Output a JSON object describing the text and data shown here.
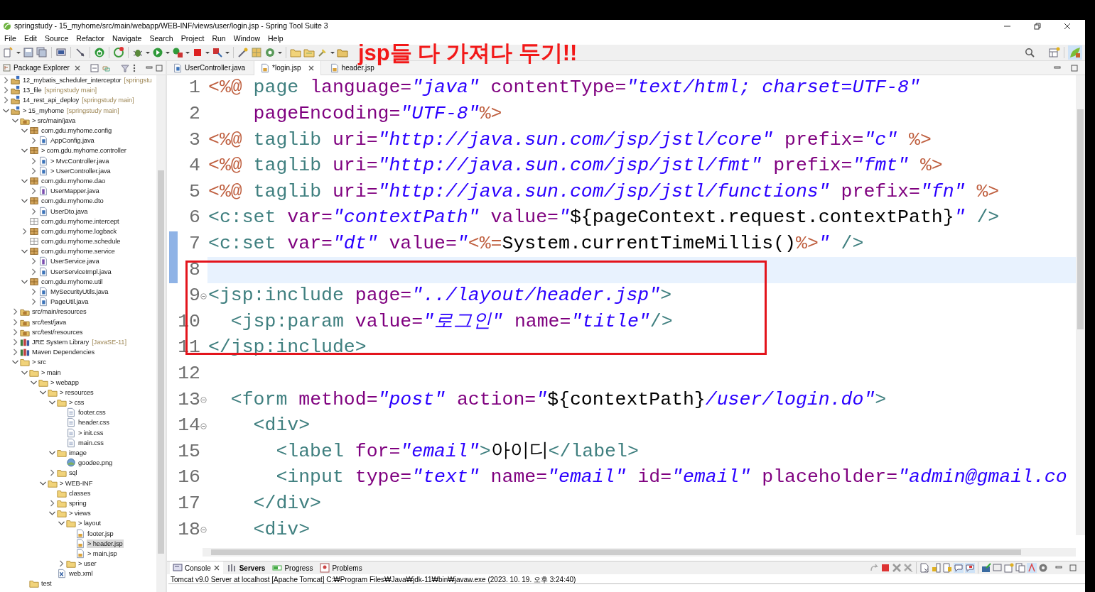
{
  "window": {
    "title": "springstudy - 15_myhome/src/main/webapp/WEB-INF/views/user/login.jsp - Spring Tool Suite 3"
  },
  "menu": [
    "File",
    "Edit",
    "Source",
    "Refactor",
    "Navigate",
    "Search",
    "Project",
    "Run",
    "Window",
    "Help"
  ],
  "annotation": {
    "text": "jsp들 다 가져다 두기!!"
  },
  "explorer": {
    "title": "Package Explorer",
    "items": [
      {
        "label": "12_mybatis_scheduler_interceptor",
        "detail": "[springstu",
        "kind": "project",
        "expanded": false,
        "selected": false
      },
      {
        "label": "13_file",
        "detail": "[springstudy main]",
        "kind": "project",
        "expanded": false,
        "selected": false
      },
      {
        "label": "14_rest_api_deploy",
        "detail": "[springstudy main]",
        "kind": "project",
        "expanded": false,
        "selected": false
      },
      {
        "label": "> 15_myhome",
        "detail": "[springstudy main]",
        "kind": "project",
        "expanded": true,
        "selected": false,
        "children": [
          {
            "label": "> src/main/java",
            "kind": "srcfolder",
            "expanded": true,
            "selected": false,
            "children": [
              {
                "label": "com.gdu.myhome.config",
                "kind": "package",
                "expanded": true,
                "selected": false,
                "children": [
                  {
                    "label": "AppConfig.java",
                    "kind": "java",
                    "expanded": false,
                    "selected": false
                  }
                ]
              },
              {
                "label": "> com.gdu.myhome.controller",
                "kind": "package",
                "expanded": true,
                "selected": false,
                "children": [
                  {
                    "label": "> MvcController.java",
                    "kind": "java",
                    "expanded": false,
                    "selected": false
                  },
                  {
                    "label": "> UserController.java",
                    "kind": "java",
                    "expanded": false,
                    "selected": false
                  }
                ]
              },
              {
                "label": "com.gdu.myhome.dao",
                "kind": "package",
                "expanded": true,
                "selected": false,
                "children": [
                  {
                    "label": "UserMapper.java",
                    "kind": "interface",
                    "expanded": false,
                    "selected": false
                  }
                ]
              },
              {
                "label": "com.gdu.myhome.dto",
                "kind": "package",
                "expanded": true,
                "selected": false,
                "children": [
                  {
                    "label": "UserDto.java",
                    "kind": "java",
                    "expanded": false,
                    "selected": false
                  }
                ]
              },
              {
                "label": "com.gdu.myhome.intercept",
                "kind": "emptypkg",
                "selected": false
              },
              {
                "label": "com.gdu.myhome.logback",
                "kind": "package",
                "expanded": false,
                "selected": false
              },
              {
                "label": "com.gdu.myhome.schedule",
                "kind": "emptypkg",
                "selected": false
              },
              {
                "label": "com.gdu.myhome.service",
                "kind": "package",
                "expanded": true,
                "selected": false,
                "children": [
                  {
                    "label": "UserService.java",
                    "kind": "interface",
                    "expanded": false,
                    "selected": false
                  },
                  {
                    "label": "UserServiceImpl.java",
                    "kind": "java",
                    "expanded": false,
                    "selected": false
                  }
                ]
              },
              {
                "label": "com.gdu.myhome.util",
                "kind": "package",
                "expanded": true,
                "selected": false,
                "children": [
                  {
                    "label": "MySecurityUtils.java",
                    "kind": "java",
                    "expanded": false,
                    "selected": false
                  },
                  {
                    "label": "PageUtil.java",
                    "kind": "java",
                    "expanded": false,
                    "selected": false
                  }
                ]
              }
            ]
          },
          {
            "label": "src/main/resources",
            "kind": "srcfolder",
            "expanded": false,
            "selected": false
          },
          {
            "label": "src/test/java",
            "kind": "srcfolder",
            "expanded": false,
            "selected": false
          },
          {
            "label": "src/test/resources",
            "kind": "srcfolder",
            "expanded": false,
            "selected": false
          },
          {
            "label": "JRE System Library",
            "detail": "[JavaSE-11]",
            "kind": "library",
            "expanded": false,
            "selected": false
          },
          {
            "label": "Maven Dependencies",
            "kind": "library",
            "expanded": false,
            "selected": false
          },
          {
            "label": "> src",
            "kind": "folder",
            "expanded": true,
            "selected": false,
            "children": [
              {
                "label": "> main",
                "kind": "folder",
                "expanded": true,
                "selected": false,
                "children": [
                  {
                    "label": "> webapp",
                    "kind": "folder",
                    "expanded": true,
                    "selected": false,
                    "children": [
                      {
                        "label": "> resources",
                        "kind": "folder",
                        "expanded": true,
                        "selected": false,
                        "children": [
                          {
                            "label": "> css",
                            "kind": "folder",
                            "expanded": true,
                            "selected": false,
                            "children": [
                              {
                                "label": "footer.css",
                                "kind": "file",
                                "selected": false
                              },
                              {
                                "label": "header.css",
                                "kind": "file",
                                "selected": false
                              },
                              {
                                "label": "> init.css",
                                "kind": "file",
                                "selected": false
                              },
                              {
                                "label": "main.css",
                                "kind": "file",
                                "selected": false
                              }
                            ]
                          },
                          {
                            "label": "image",
                            "kind": "folder",
                            "expanded": true,
                            "selected": false,
                            "children": [
                              {
                                "label": "goodee.png",
                                "kind": "image",
                                "selected": false
                              }
                            ]
                          },
                          {
                            "label": "sql",
                            "kind": "folder",
                            "expanded": false,
                            "selected": false
                          }
                        ]
                      },
                      {
                        "label": "> WEB-INF",
                        "kind": "folder",
                        "expanded": true,
                        "selected": false,
                        "children": [
                          {
                            "label": "classes",
                            "kind": "folder",
                            "selected": false
                          },
                          {
                            "label": "spring",
                            "kind": "folder",
                            "expanded": false,
                            "selected": false
                          },
                          {
                            "label": "> views",
                            "kind": "folder",
                            "expanded": true,
                            "selected": false,
                            "children": [
                              {
                                "label": "> layout",
                                "kind": "folder",
                                "expanded": true,
                                "selected": false,
                                "children": [
                                  {
                                    "label": "footer.jsp",
                                    "kind": "jsp",
                                    "selected": false
                                  },
                                  {
                                    "label": "> header.jsp",
                                    "kind": "jsp",
                                    "selected": true
                                  },
                                  {
                                    "label": "> main.jsp",
                                    "kind": "jsp",
                                    "selected": false
                                  }
                                ]
                              },
                              {
                                "label": "> user",
                                "kind": "folder",
                                "expanded": false,
                                "selected": false
                              }
                            ]
                          },
                          {
                            "label": "web.xml",
                            "kind": "xml",
                            "selected": false
                          }
                        ]
                      }
                    ]
                  }
                ]
              },
              {
                "label": "test",
                "kind": "folder",
                "selected": false
              }
            ]
          }
        ]
      }
    ]
  },
  "editor": {
    "tabs": [
      {
        "label": "UserController.java",
        "kind": "java",
        "selected": false
      },
      {
        "label": "*login.jsp",
        "kind": "jsp",
        "selected": true
      },
      {
        "label": "header.jsp",
        "kind": "jsp",
        "selected": false
      }
    ],
    "lines": [
      {
        "number": "1",
        "current": false,
        "changed": false,
        "fold": false,
        "tokens": [
          {
            "kind": "dir",
            "text": "<%@"
          },
          {
            "kind": "kw",
            "text": " page"
          },
          {
            "kind": "attr",
            "text": " language="
          },
          {
            "kind": "val",
            "text": "\"java\""
          },
          {
            "kind": "attr",
            "text": " contentType="
          },
          {
            "kind": "val",
            "text": "\"text/html; charset=UTF-8\""
          }
        ]
      },
      {
        "number": "2",
        "current": false,
        "changed": false,
        "fold": false,
        "tokens": [
          {
            "kind": "attr",
            "text": "    pageEncoding="
          },
          {
            "kind": "val",
            "text": "\"UTF-8\""
          },
          {
            "kind": "dir",
            "text": "%>"
          }
        ]
      },
      {
        "number": "3",
        "current": false,
        "changed": false,
        "fold": false,
        "tokens": [
          {
            "kind": "dir",
            "text": "<%@"
          },
          {
            "kind": "kw",
            "text": " taglib"
          },
          {
            "kind": "attr",
            "text": " uri="
          },
          {
            "kind": "val",
            "text": "\"http://java.sun.com/jsp/jstl/core\""
          },
          {
            "kind": "attr",
            "text": " prefix="
          },
          {
            "kind": "val",
            "text": "\"c\""
          },
          {
            "kind": "dir",
            "text": " %>"
          }
        ]
      },
      {
        "number": "4",
        "current": false,
        "changed": false,
        "fold": false,
        "tokens": [
          {
            "kind": "dir",
            "text": "<%@"
          },
          {
            "kind": "kw",
            "text": " taglib"
          },
          {
            "kind": "attr",
            "text": " uri="
          },
          {
            "kind": "val",
            "text": "\"http://java.sun.com/jsp/jstl/fmt\""
          },
          {
            "kind": "attr",
            "text": " prefix="
          },
          {
            "kind": "val",
            "text": "\"fmt\""
          },
          {
            "kind": "dir",
            "text": " %>"
          }
        ]
      },
      {
        "number": "5",
        "current": false,
        "changed": false,
        "fold": false,
        "tokens": [
          {
            "kind": "dir",
            "text": "<%@"
          },
          {
            "kind": "kw",
            "text": " taglib"
          },
          {
            "kind": "attr",
            "text": " uri="
          },
          {
            "kind": "val",
            "text": "\"http://java.sun.com/jsp/jstl/functions\""
          },
          {
            "kind": "attr",
            "text": " prefix="
          },
          {
            "kind": "val",
            "text": "\"fn\""
          },
          {
            "kind": "dir",
            "text": " %>"
          }
        ]
      },
      {
        "number": "6",
        "current": false,
        "changed": false,
        "fold": false,
        "tokens": [
          {
            "kind": "tag",
            "text": "<c:set"
          },
          {
            "kind": "attr",
            "text": " var="
          },
          {
            "kind": "val",
            "text": "\"contextPath\""
          },
          {
            "kind": "attr",
            "text": " value="
          },
          {
            "kind": "val",
            "text": "\""
          },
          {
            "kind": "text",
            "text": "${pageContext.request.contextPath}"
          },
          {
            "kind": "val",
            "text": "\""
          },
          {
            "kind": "tag",
            "text": " />"
          }
        ]
      },
      {
        "number": "7",
        "current": false,
        "changed": true,
        "fold": false,
        "tokens": [
          {
            "kind": "tag",
            "text": "<c:set"
          },
          {
            "kind": "attr",
            "text": " var="
          },
          {
            "kind": "val",
            "text": "\"dt\""
          },
          {
            "kind": "attr",
            "text": " value="
          },
          {
            "kind": "val",
            "text": "\""
          },
          {
            "kind": "dir",
            "text": "<%="
          },
          {
            "kind": "text",
            "text": "System.currentTimeMillis()"
          },
          {
            "kind": "dir",
            "text": "%>"
          },
          {
            "kind": "val",
            "text": "\""
          },
          {
            "kind": "tag",
            "text": " />"
          }
        ]
      },
      {
        "number": "8",
        "current": true,
        "changed": true,
        "fold": false
      },
      {
        "number": "9",
        "current": false,
        "changed": false,
        "fold": true,
        "tokens": [
          {
            "kind": "tag",
            "text": "<jsp:include"
          },
          {
            "kind": "attr",
            "text": " page="
          },
          {
            "kind": "val",
            "text": "\"../layout/header.jsp\""
          },
          {
            "kind": "tag",
            "text": ">"
          }
        ]
      },
      {
        "number": "10",
        "current": false,
        "changed": false,
        "fold": false,
        "tokens": [
          {
            "kind": "tag",
            "text": "  <jsp:param"
          },
          {
            "kind": "attr",
            "text": " value="
          },
          {
            "kind": "val",
            "text": "\"로그인\""
          },
          {
            "kind": "attr",
            "text": " name="
          },
          {
            "kind": "val",
            "text": "\"title\""
          },
          {
            "kind": "tag",
            "text": "/>"
          }
        ]
      },
      {
        "number": "11",
        "current": false,
        "changed": false,
        "fold": false,
        "tokens": [
          {
            "kind": "tag",
            "text": "</jsp:include>"
          }
        ]
      },
      {
        "number": "12",
        "current": false,
        "changed": false,
        "fold": false
      },
      {
        "number": "13",
        "current": false,
        "changed": false,
        "fold": true,
        "tokens": [
          {
            "kind": "tag",
            "text": "  <form"
          },
          {
            "kind": "attr",
            "text": " method="
          },
          {
            "kind": "val",
            "text": "\"post\""
          },
          {
            "kind": "attr",
            "text": " action="
          },
          {
            "kind": "val",
            "text": "\""
          },
          {
            "kind": "text",
            "text": "${contextPath}"
          },
          {
            "kind": "val",
            "text": "/user/login.do\""
          },
          {
            "kind": "tag",
            "text": ">"
          }
        ]
      },
      {
        "number": "14",
        "current": false,
        "changed": false,
        "fold": true,
        "tokens": [
          {
            "kind": "tag",
            "text": "    <div>"
          }
        ]
      },
      {
        "number": "15",
        "current": false,
        "changed": false,
        "fold": false,
        "tokens": [
          {
            "kind": "tag",
            "text": "      <label"
          },
          {
            "kind": "attr",
            "text": " for="
          },
          {
            "kind": "val",
            "text": "\"email\""
          },
          {
            "kind": "tag",
            "text": ">"
          },
          {
            "kind": "text",
            "text": "아이디"
          },
          {
            "kind": "tag",
            "text": "</label>"
          }
        ]
      },
      {
        "number": "16",
        "current": false,
        "changed": false,
        "fold": false,
        "tokens": [
          {
            "kind": "tag",
            "text": "      <input"
          },
          {
            "kind": "attr",
            "text": " type="
          },
          {
            "kind": "val",
            "text": "\"text\""
          },
          {
            "kind": "attr",
            "text": " name="
          },
          {
            "kind": "val",
            "text": "\"email\""
          },
          {
            "kind": "attr",
            "text": " id="
          },
          {
            "kind": "val",
            "text": "\"email\""
          },
          {
            "kind": "attr",
            "text": " placeholder="
          },
          {
            "kind": "val",
            "text": "\"admin@gmail.co"
          }
        ]
      },
      {
        "number": "17",
        "current": false,
        "changed": false,
        "fold": false,
        "tokens": [
          {
            "kind": "tag",
            "text": "    </div>"
          }
        ]
      },
      {
        "number": "18",
        "current": false,
        "changed": false,
        "fold": true,
        "tokens": [
          {
            "kind": "tag",
            "text": "    <div>"
          }
        ]
      }
    ]
  },
  "console": {
    "tabs": [
      {
        "label": "Console",
        "kind": "console",
        "selected": true,
        "emphasized": false
      },
      {
        "label": "Servers",
        "kind": "servers",
        "selected": false,
        "emphasized": true
      },
      {
        "label": "Progress",
        "kind": "progress",
        "selected": false,
        "emphasized": false
      },
      {
        "label": "Problems",
        "kind": "problems",
        "selected": false,
        "emphasized": false
      }
    ],
    "status": "Tomcat v9.0 Server at localhost [Apache Tomcat] C:₩Program Files₩Java₩jdk-11₩bin₩javaw.exe  (2023. 10. 19. 오후 3:24:40)"
  }
}
